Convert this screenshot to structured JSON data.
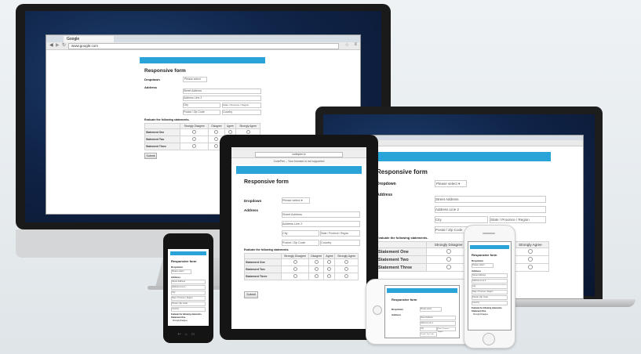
{
  "colors": {
    "accent": "#2aa3d8",
    "space": "#10254a"
  },
  "browser": {
    "tab_title": "Google",
    "url": "www.google.com"
  },
  "tablet_browser": {
    "url": "codepen.io",
    "notice": "CodePen – Your browser is not supported"
  },
  "form": {
    "title": "Responsive form",
    "dropdown_label": "Dropdown",
    "dropdown_value": "Please select",
    "address_label": "Address",
    "street": "Street Address",
    "address2": "Address Line 2",
    "city": "City",
    "state": "State / Province / Region",
    "postal": "Postal / Zip Code",
    "country": "Country",
    "evaluate": "Evaluate the following statements.",
    "columns": [
      "Strongly Disagree",
      "Disagree",
      "Agree",
      "Strongly Agree"
    ],
    "statements": [
      "Statement One",
      "Statement Two",
      "Statement Three"
    ],
    "submit": "Submit"
  }
}
